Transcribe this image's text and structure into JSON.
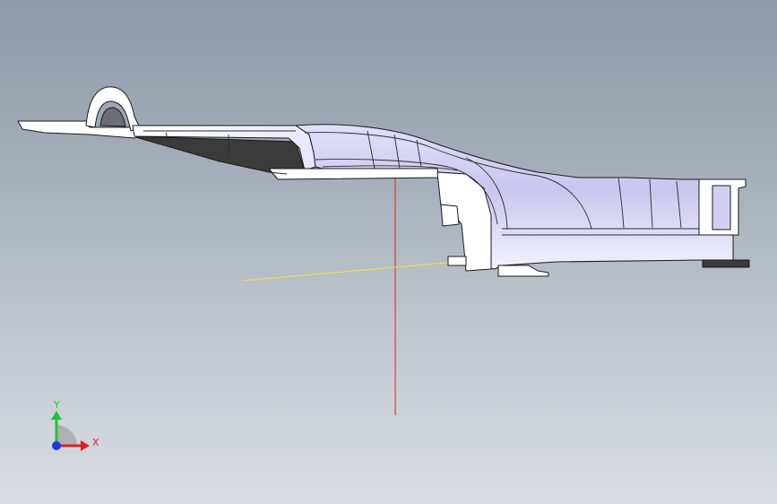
{
  "viewport": {
    "background_top": "#8d9aa8",
    "background_bottom": "#d9dde2"
  },
  "model": {
    "fill_color": "#ffffff",
    "shaded_color": "#c9c6ef",
    "edge_color": "#1a1a1a",
    "cavity_color": "#3a3a3a"
  },
  "reference_axes": {
    "vertical_color": "#e02020",
    "horizontal_color": "#ffe03a"
  },
  "triad": {
    "x_label": "X",
    "y_label": "Y",
    "x_color": "#e02020",
    "y_color": "#22c23a",
    "z_color": "#1a3adf"
  }
}
